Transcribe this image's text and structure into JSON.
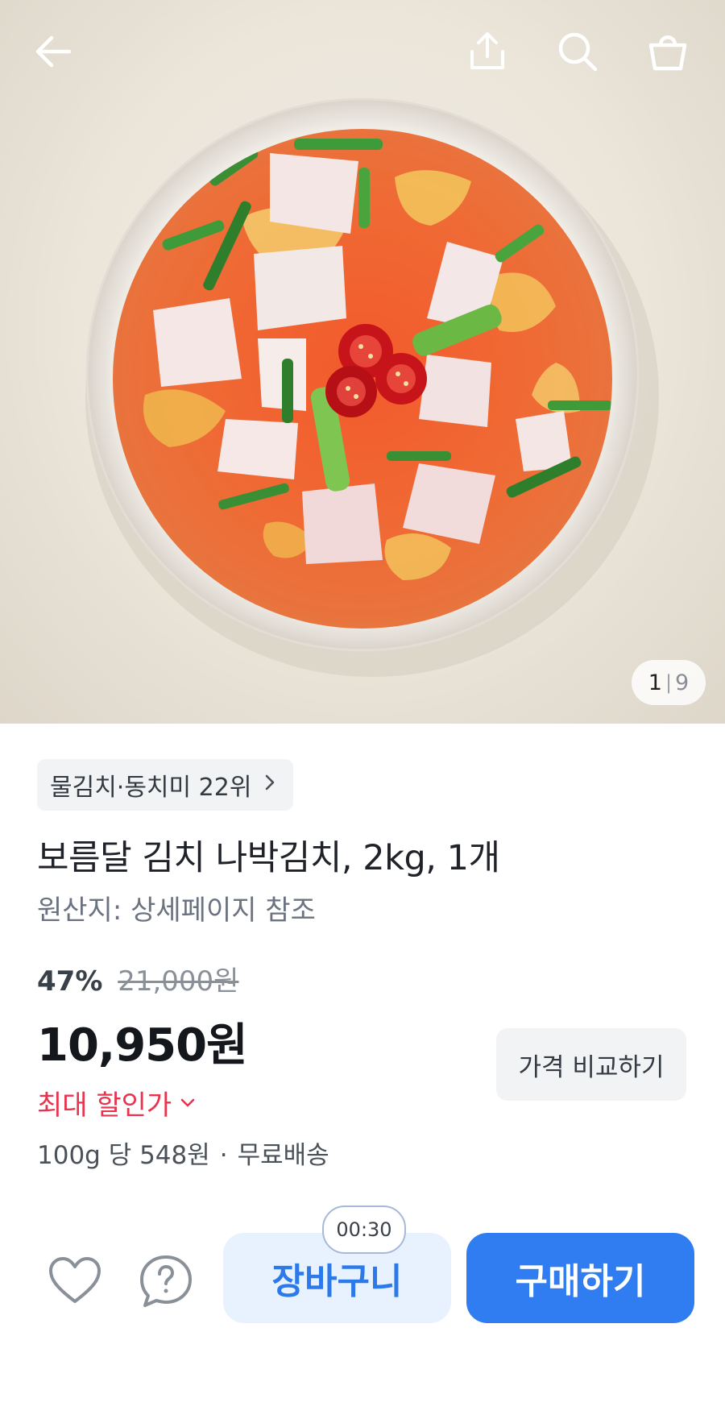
{
  "header": {
    "back_icon": "arrow-left-icon",
    "share_icon": "share-icon",
    "search_icon": "search-icon",
    "cart_icon": "shopping-bag-icon"
  },
  "gallery": {
    "current": "1",
    "total": "9"
  },
  "product": {
    "rank_label": "물김치·동치미 22위",
    "title": "보름달 김치 나박김치, 2kg, 1개",
    "origin": "원산지: 상세페이지 참조",
    "discount_percent": "47%",
    "original_price": "21,000원",
    "price": "10,950원",
    "max_discount_label": "최대 할인가",
    "unit_price": "100g 당 548원",
    "shipping": "무료배송",
    "compare_button": "가격 비교하기"
  },
  "actions": {
    "wishlist_icon": "heart-icon",
    "inquiry_icon": "question-bubble-icon",
    "timer": "00:30",
    "cart_button": "장바구니",
    "buy_button": "구매하기"
  },
  "colors": {
    "accent": "#2f7df0",
    "discount_red": "#e8344e",
    "cart_bg": "#e8f2ff"
  }
}
